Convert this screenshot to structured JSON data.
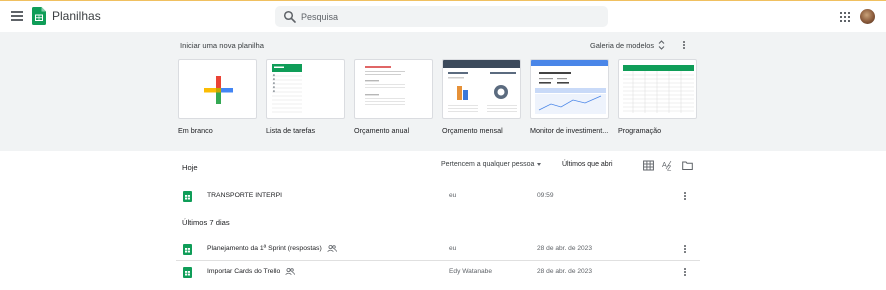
{
  "header": {
    "app_name": "Planilhas",
    "search_placeholder": "Pesquisa",
    "icons": [
      "menu-icon",
      "sheets-logo",
      "search-icon",
      "apps-grid-icon",
      "avatar"
    ]
  },
  "templates": {
    "heading": "Iniciar uma nova planilha",
    "gallery_label": "Galeria de modelos",
    "items": [
      {
        "label": "Em branco"
      },
      {
        "label": "Lista de tarefas"
      },
      {
        "label": "Orçamento anual"
      },
      {
        "label": "Orçamento mensal"
      },
      {
        "label": "Monitor de investiment..."
      },
      {
        "label": "Programação"
      }
    ]
  },
  "list": {
    "today_label": "Hoje",
    "owner_filter": "Pertencem a qualquer pessoa",
    "sort_label": "Últimos que abri",
    "last7_label": "Últimos 7 dias",
    "files": [
      {
        "name": "TRANSPORTE INTERPI",
        "owner": "eu",
        "date": "09:59",
        "shared": false
      },
      {
        "name": "Planejamento da 1ª Sprint (respostas)",
        "owner": "eu",
        "date": "28 de abr. de 2023",
        "shared": true
      },
      {
        "name": "Importar Cards do Trello",
        "owner": "Edy Watanabe",
        "date": "28 de abr. de 2023",
        "shared": true
      }
    ]
  },
  "colors": {
    "sheets_green": "#0f9d58",
    "template_band": "#f1f3f4",
    "search_bg": "#f1f3f4"
  }
}
